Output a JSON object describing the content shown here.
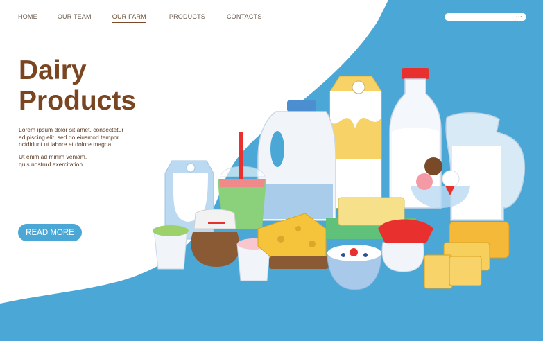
{
  "nav": {
    "items": [
      {
        "label": "HOME",
        "active": false
      },
      {
        "label": "OUR TEAM",
        "active": false
      },
      {
        "label": "OUR FARM",
        "active": true
      },
      {
        "label": "PRODUCTS",
        "active": false
      },
      {
        "label": "CONTACTS",
        "active": false
      }
    ]
  },
  "search": {
    "menu_glyph": "..."
  },
  "hero": {
    "title_line1": "Dairy",
    "title_line2": "Products",
    "paragraph1_line1": "Lorem ipsum dolor sit amet, consectetur",
    "paragraph1_line2": "adipiscing elit, sed do eiusmod tempor",
    "paragraph1_line3": "ncididunt ut labore et dolore magna",
    "paragraph2_line1": "Ut enim ad minim veniam,",
    "paragraph2_line2": "quis nostrud exercitation",
    "button_label": "READ MORE"
  },
  "colors": {
    "background_blue": "#4ba8d6",
    "title_brown": "#7a4521",
    "button_blue": "#4ba8d6"
  },
  "illustration": {
    "items": [
      "milk-carton-icon",
      "milkshake-cup-icon",
      "milk-jug-icon",
      "juice-carton-icon",
      "milk-bottle-icon",
      "milk-pitcher-icon",
      "yogurt-cup-icon",
      "jam-jar-icon",
      "cheese-wedge-icon",
      "butter-dish-icon",
      "cottage-cheese-bowl-icon",
      "ice-cream-bowl-icon",
      "cheese-block-icon"
    ]
  }
}
